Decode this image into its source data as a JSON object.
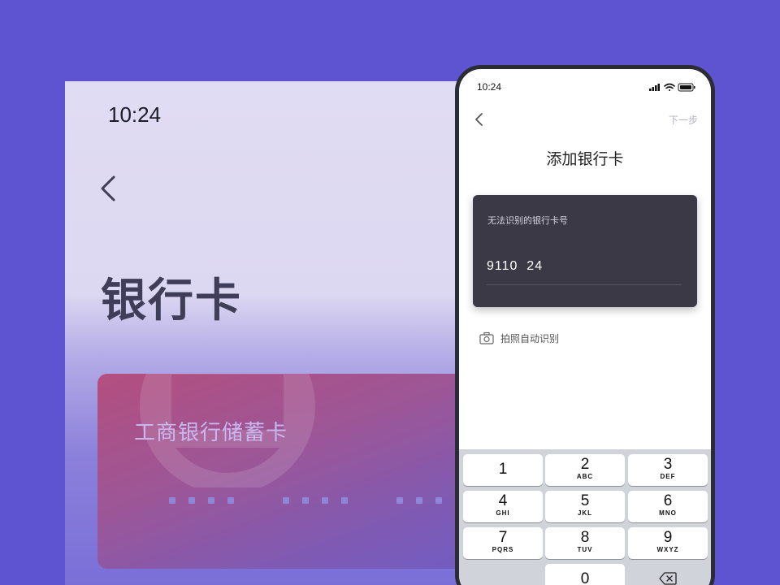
{
  "background_screen": {
    "time": "10:24",
    "title": "银行卡",
    "card_name": "工商银行储蓄卡"
  },
  "phone": {
    "status_time": "10:24",
    "next_label": "下一步",
    "page_title": "添加银行卡",
    "card": {
      "caption": "无法识别的银行卡号",
      "number_value": "9110  24"
    },
    "scan_label": "拍照自动识别",
    "keypad": {
      "keys": [
        {
          "num": "1",
          "letters": ""
        },
        {
          "num": "2",
          "letters": "ABC"
        },
        {
          "num": "3",
          "letters": "DEF"
        },
        {
          "num": "4",
          "letters": "GHI"
        },
        {
          "num": "5",
          "letters": "JKL"
        },
        {
          "num": "6",
          "letters": "MNO"
        },
        {
          "num": "7",
          "letters": "PQRS"
        },
        {
          "num": "8",
          "letters": "TUV"
        },
        {
          "num": "9",
          "letters": "WXYZ"
        },
        {
          "num": "0",
          "letters": ""
        }
      ]
    }
  },
  "colors": {
    "page_background": "#5e54d2",
    "card_dark": "#3b3946",
    "keypad_background": "#d0d3d9"
  }
}
